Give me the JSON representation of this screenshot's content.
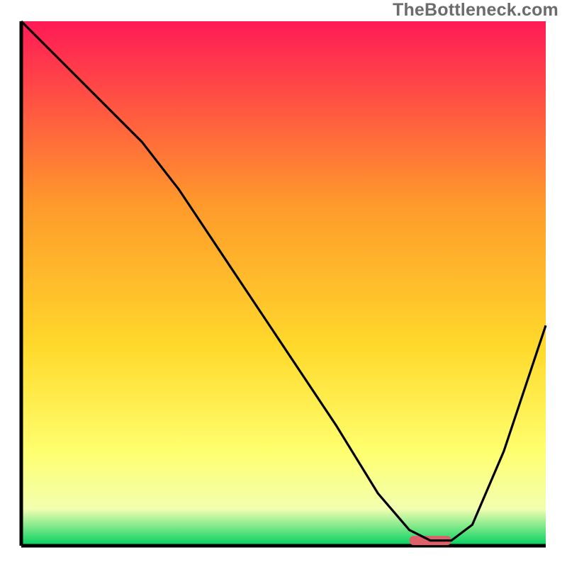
{
  "watermark": "TheBottleneck.com",
  "colors": {
    "gradient_top": "#ff1a56",
    "gradient_upper_mid": "#ff9a2b",
    "gradient_mid": "#ffd92b",
    "gradient_lower_mid": "#ffff6e",
    "gradient_low": "#f2ffb0",
    "gradient_bottom": "#00d060",
    "marker": "#e0606a",
    "axis": "#000000",
    "curve": "#000000"
  },
  "chart_data": {
    "type": "line",
    "title": "",
    "xlabel": "",
    "ylabel": "",
    "xlim": [
      0,
      100
    ],
    "ylim": [
      0,
      100
    ],
    "curve": {
      "x": [
        0,
        12,
        23,
        30,
        40,
        50,
        60,
        68,
        74,
        78,
        82,
        86,
        92,
        100
      ],
      "y": [
        100,
        88,
        77,
        68,
        53,
        38,
        23,
        10,
        3,
        1,
        1,
        4,
        18,
        42
      ]
    },
    "optimal_band": {
      "x_start": 74,
      "x_end": 82,
      "y": 1
    },
    "annotations": []
  }
}
